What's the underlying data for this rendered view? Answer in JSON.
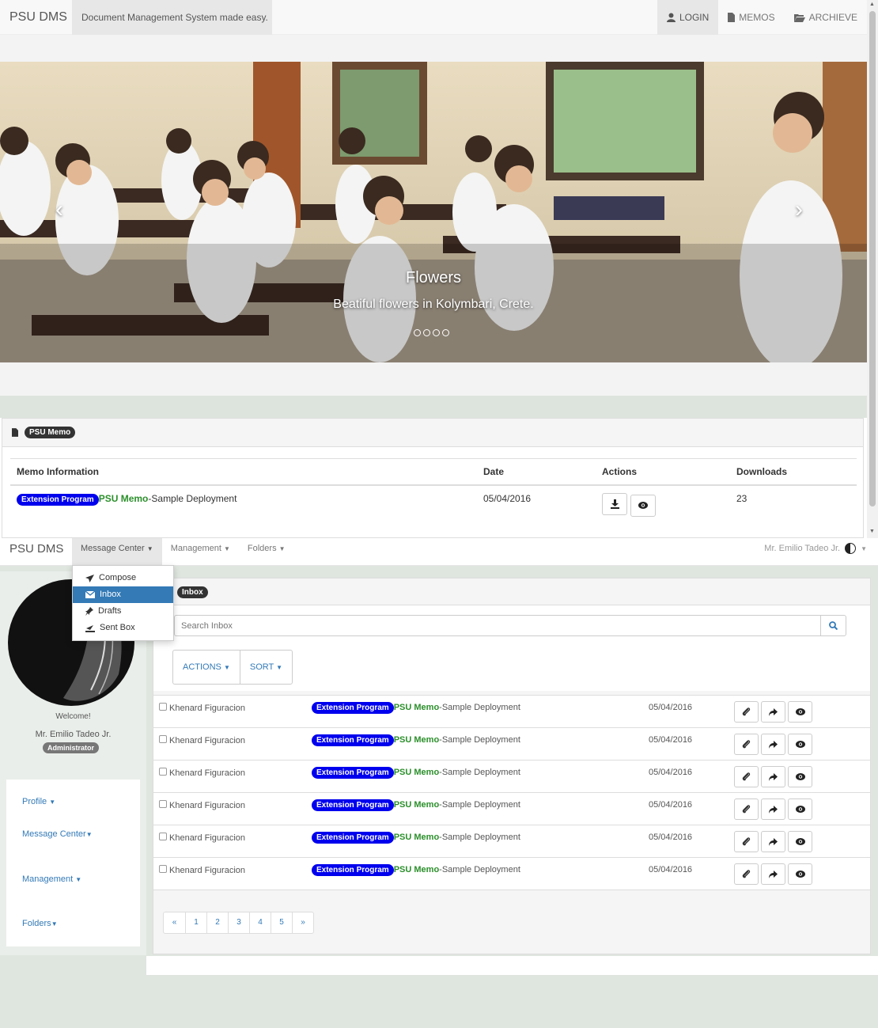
{
  "top": {
    "brand": "PSU DMS",
    "tagline": "Document Management System made easy.",
    "nav": [
      {
        "label": "LOGIN",
        "icon": "user-icon"
      },
      {
        "label": "MEMOS",
        "icon": "file-icon"
      },
      {
        "label": "ARCHIEVE",
        "icon": "folder-open-icon"
      }
    ],
    "carousel": {
      "caption_title": "Flowers",
      "caption_text": "Beatiful flowers in Kolymbari, Crete.",
      "prev": "‹",
      "next": "›"
    },
    "memo_panel": {
      "badge": "PSU Memo",
      "columns": [
        "Memo Information",
        "Date",
        "Actions",
        "Downloads"
      ],
      "row": {
        "tag": "Extension Program",
        "title_bold": "PSU Memo",
        "title_rest": "-Sample Deployment",
        "date": "05/04/2016",
        "downloads": "23"
      }
    }
  },
  "bottom": {
    "brand": "PSU DMS",
    "menu": [
      "Message Center",
      "Management",
      "Folders"
    ],
    "user": "Mr. Emilio Tadeo Jr.",
    "dropdown": [
      {
        "label": "Compose",
        "icon": "send-icon"
      },
      {
        "label": "Inbox",
        "icon": "envelope-icon"
      },
      {
        "label": "Drafts",
        "icon": "pushpin-icon"
      },
      {
        "label": "Sent Box",
        "icon": "sent-icon"
      }
    ],
    "sidebar": {
      "welcome": "Welcome!",
      "name": "Mr. Emilio Tadeo Jr.",
      "role": "Administrator",
      "menu": [
        "Profile",
        "Message Center",
        "Management",
        "Folders"
      ]
    },
    "inbox": {
      "badge": "Inbox",
      "search_placeholder": "Search Inbox",
      "actions_label": "ACTIONS",
      "sort_label": "SORT",
      "rows": [
        {
          "sender": "Khenard Figuracion",
          "tag": "Extension Program",
          "title_bold": "PSU Memo",
          "title_rest": "-Sample Deployment",
          "date": "05/04/2016"
        },
        {
          "sender": "Khenard Figuracion",
          "tag": "Extension Program",
          "title_bold": "PSU Memo",
          "title_rest": "-Sample Deployment",
          "date": "05/04/2016"
        },
        {
          "sender": "Khenard Figuracion",
          "tag": "Extension Program",
          "title_bold": "PSU Memo",
          "title_rest": "-Sample Deployment",
          "date": "05/04/2016"
        },
        {
          "sender": "Khenard Figuracion",
          "tag": "Extension Program",
          "title_bold": "PSU Memo",
          "title_rest": "-Sample Deployment",
          "date": "05/04/2016"
        },
        {
          "sender": "Khenard Figuracion",
          "tag": "Extension Program",
          "title_bold": "PSU Memo",
          "title_rest": "-Sample Deployment",
          "date": "05/04/2016"
        },
        {
          "sender": "Khenard Figuracion",
          "tag": "Extension Program",
          "title_bold": "PSU Memo",
          "title_rest": "-Sample Deployment",
          "date": "05/04/2016"
        }
      ],
      "pagination": [
        "«",
        "1",
        "2",
        "3",
        "4",
        "5",
        "»"
      ]
    }
  },
  "colors": {
    "tag_blue": "#0000ee",
    "psu_green": "#2b8f2b",
    "link_blue": "#337ab7",
    "selected_blue": "#337ab7"
  }
}
